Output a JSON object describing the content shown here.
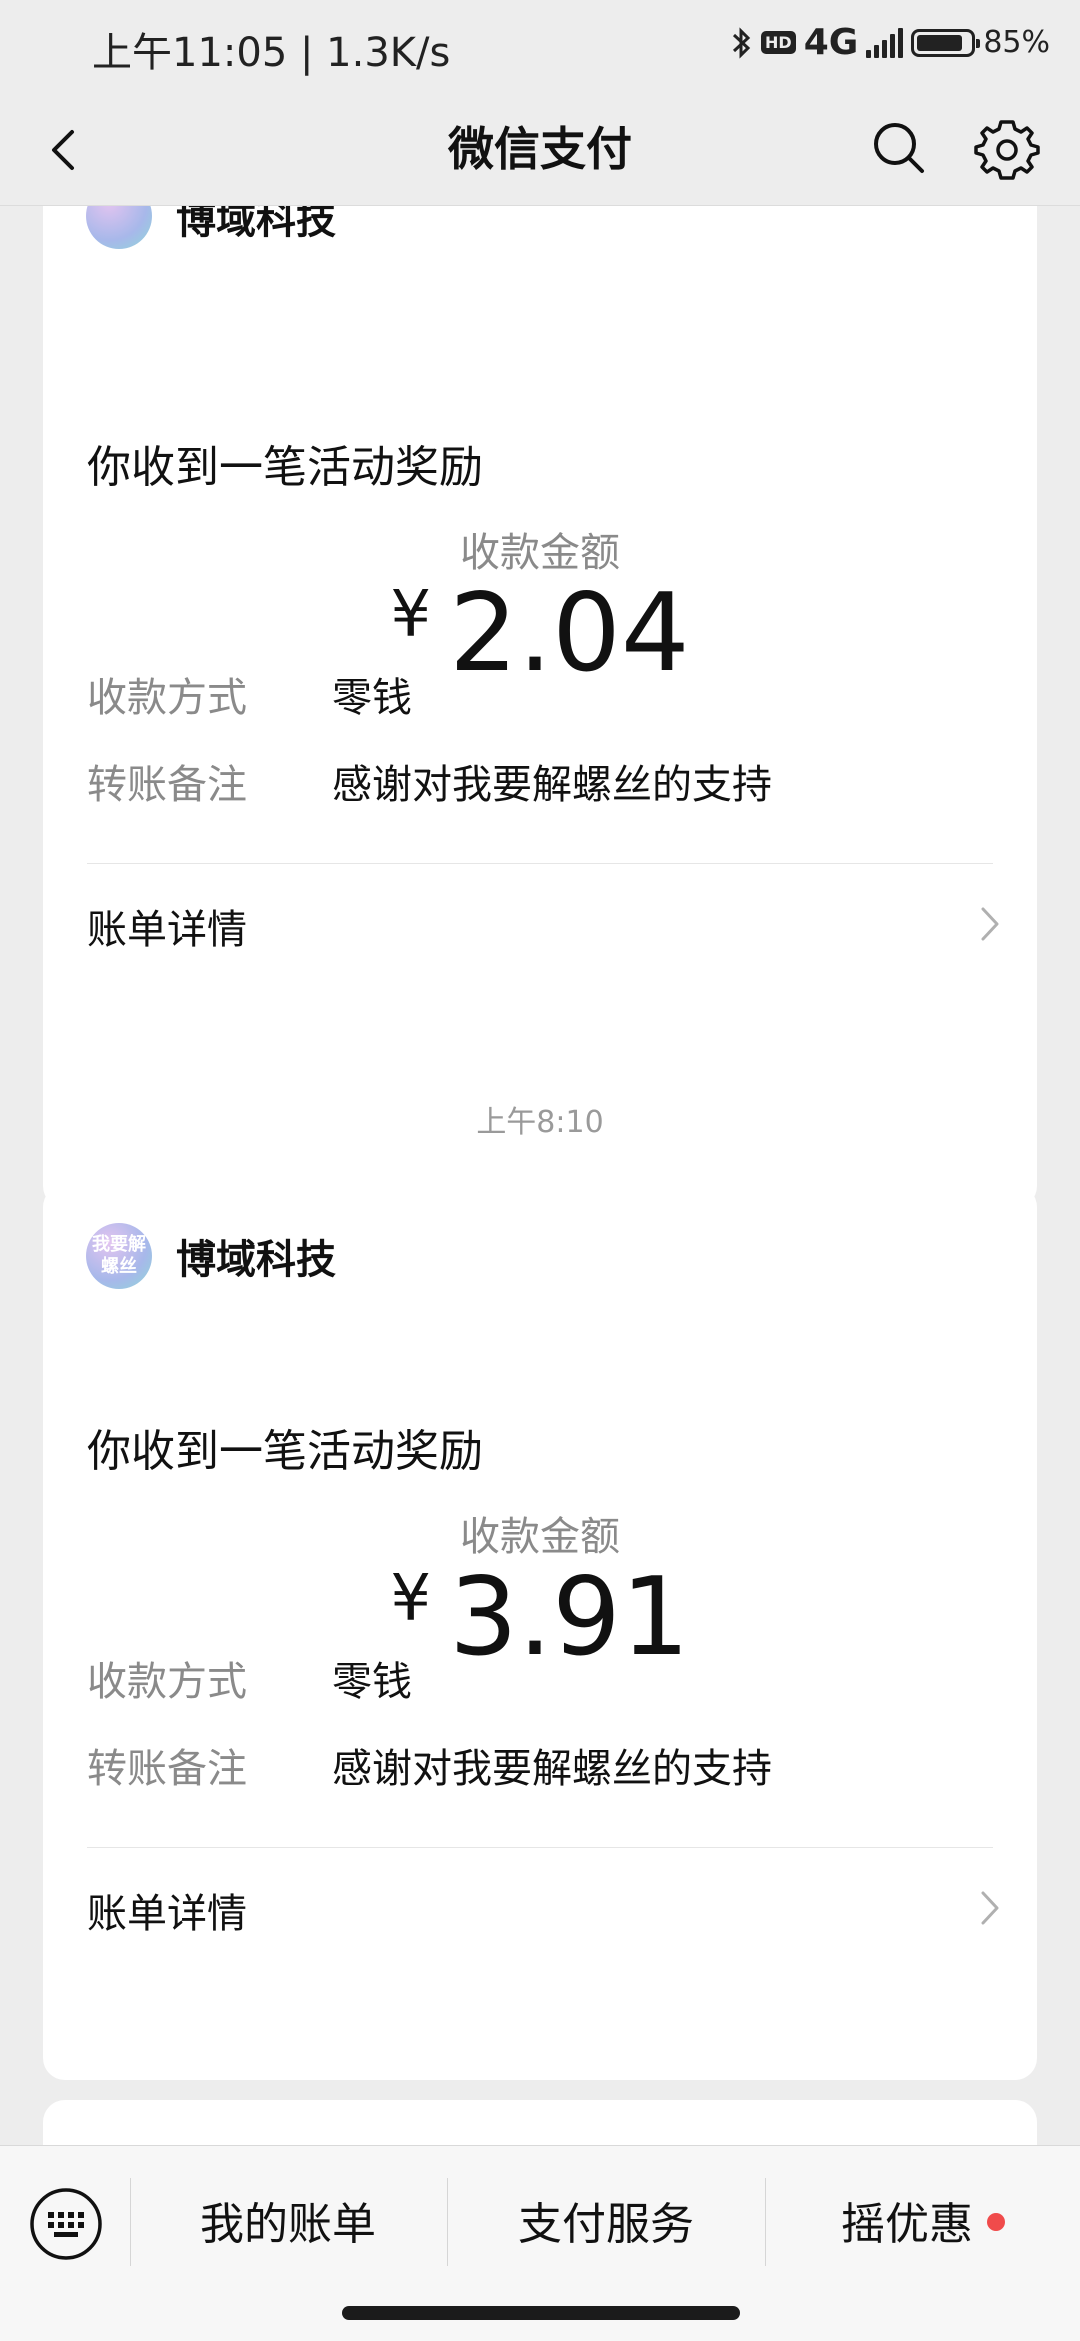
{
  "status_bar": {
    "time_speed": "上午11:05 | 1.3K/s",
    "network": "4G",
    "hd_label": "HD",
    "battery_percent": "85%",
    "battery_level": 0.85
  },
  "nav": {
    "title": "微信支付",
    "back_icon": "back-arrow-icon",
    "search_icon": "search-icon",
    "settings_icon": "gear-icon"
  },
  "messages": [
    {
      "sender": "博域科技",
      "title": "你收到一笔活动奖励",
      "amount_label": "收款金额",
      "currency": "¥",
      "amount": "2.04",
      "method_key": "收款方式",
      "method_value": "零钱",
      "note_key": "转账备注",
      "note_value": "感谢对我要解螺丝的支持",
      "details_label": "账单详情"
    },
    {
      "timestamp": "上午8:10",
      "sender": "博域科技",
      "avatar_text": "我要解螺丝",
      "title": "你收到一笔活动奖励",
      "amount_label": "收款金额",
      "currency": "¥",
      "amount": "3.91",
      "method_key": "收款方式",
      "method_value": "零钱",
      "note_key": "转账备注",
      "note_value": "感谢对我要解螺丝的支持",
      "details_label": "账单详情"
    }
  ],
  "bottom_menu": {
    "keyboard_icon": "keyboard-icon",
    "items": [
      "我的账单",
      "支付服务",
      "摇优惠"
    ],
    "badge_color": "#f04b4b"
  }
}
